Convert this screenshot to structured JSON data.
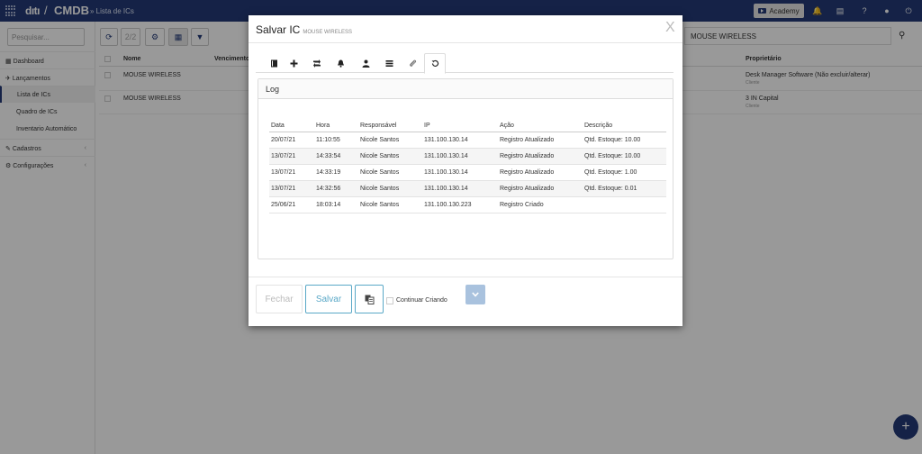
{
  "topbar": {
    "logo_text": "dıtı",
    "separator": "/",
    "module": "CMDB",
    "breadcrumb": "» Lista de ICs",
    "academy_label": "Academy"
  },
  "sidebar": {
    "search_placeholder": "Pesquisar...",
    "items": [
      {
        "label": "Dashboard"
      },
      {
        "label": "Lançamentos"
      },
      {
        "label": "Lista de ICs"
      },
      {
        "label": "Quadro de ICs"
      },
      {
        "label": "Inventario Automático"
      },
      {
        "label": "Cadastros"
      },
      {
        "label": "Configurações"
      }
    ]
  },
  "list": {
    "pager": "2/2",
    "right_search_value": "MOUSE WIRELESS",
    "headers": {
      "nome": "Nome",
      "vencimento": "Vencimento",
      "proprietario": "Proprietário"
    },
    "rows": [
      {
        "nome": "MOUSE WIRELESS",
        "proprietario": "Desk Manager Software (Não excluir/alterar)",
        "tipo": "Cliente"
      },
      {
        "nome": "MOUSE WIRELESS",
        "proprietario": "3 IN Capital",
        "tipo": "Cliente"
      }
    ]
  },
  "modal": {
    "title": "Salvar IC",
    "subtitle": "MOUSE WIRELESS",
    "close": "X",
    "panel_title": "Log",
    "columns": [
      "Data",
      "Hora",
      "Responsável",
      "IP",
      "Ação",
      "Descrição"
    ],
    "rows": [
      [
        "20/07/21",
        "11:10:55",
        "Nicole Santos",
        "131.100.130.14",
        "Registro Atualizado",
        "Qtd. Estoque: 10.00"
      ],
      [
        "13/07/21",
        "14:33:54",
        "Nicole Santos",
        "131.100.130.14",
        "Registro Atualizado",
        "Qtd. Estoque: 10.00"
      ],
      [
        "13/07/21",
        "14:33:19",
        "Nicole Santos",
        "131.100.130.14",
        "Registro Atualizado",
        "Qtd. Estoque: 1.00"
      ],
      [
        "13/07/21",
        "14:32:56",
        "Nicole Santos",
        "131.100.130.14",
        "Registro Atualizado",
        "Qtd. Estoque: 0.01"
      ],
      [
        "25/06/21",
        "18:03:14",
        "Nicole Santos",
        "131.100.130.223",
        "Registro Criado",
        ""
      ]
    ],
    "btn_close": "Fechar",
    "btn_save": "Salvar",
    "continue_label": "Continuar Criando"
  },
  "colors": {
    "primary": "#233a77",
    "accent": "#5aa8c7",
    "more_btn": "#a9c2de"
  }
}
